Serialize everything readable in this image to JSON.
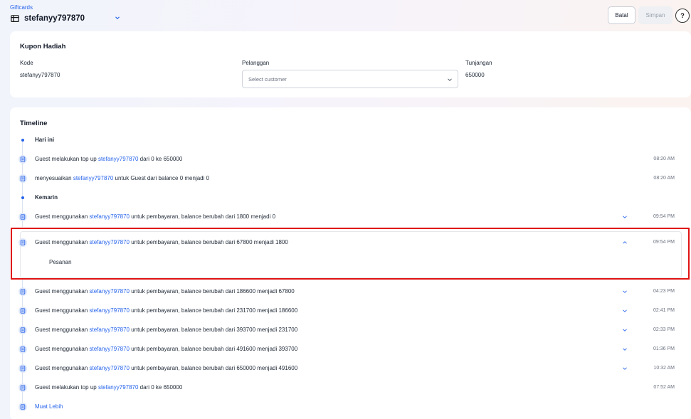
{
  "breadcrumb": "Giftcards",
  "header": {
    "title": "stefanyy797870",
    "icons": {
      "gift": "gift-card-icon",
      "dropdown": "chevron-down-icon"
    },
    "buttons": {
      "cancel": "Batal",
      "save": "Simpan",
      "help": "?"
    }
  },
  "kupon": {
    "title": "Kupon Hadiah",
    "kode_label": "Kode",
    "kode_value": "stefanyy797870",
    "pelanggan_label": "Pelanggan",
    "pelanggan_placeholder": "Select customer",
    "tunjangan_label": "Tunjangan",
    "tunjangan_value": "650000"
  },
  "timeline": {
    "title": "Timeline",
    "groups": {
      "today": "Hari ini",
      "yesterday": "Kemarin"
    },
    "rows": [
      {
        "pre": "Guest melakukan top up ",
        "link": "stefanyy797870",
        "post": " dari 0 ke 650000",
        "time": "08:20 AM"
      },
      {
        "pre": "menyesuaikan ",
        "link": "stefanyy797870",
        "post": " untuk Guest dari balance 0 menjadi 0",
        "time": "08:20 AM"
      },
      {
        "pre": "Guest menggunakan ",
        "link": "stefanyy797870",
        "post": " untuk pembayaran, balance berubah dari 1800 menjadi 0",
        "time": "09:54 PM"
      },
      {
        "pre": "Guest menggunakan ",
        "link": "stefanyy797870",
        "post": " untuk pembayaran, balance berubah dari 67800 menjadi 1800",
        "time": "09:54 PM",
        "detail": "Pesanan"
      },
      {
        "pre": "Guest menggunakan ",
        "link": "stefanyy797870",
        "post": " untuk pembayaran, balance berubah dari 186600 menjadi 67800",
        "time": "04:23 PM"
      },
      {
        "pre": "Guest menggunakan ",
        "link": "stefanyy797870",
        "post": " untuk pembayaran, balance berubah dari 231700 menjadi 186600",
        "time": "02:41 PM"
      },
      {
        "pre": "Guest menggunakan ",
        "link": "stefanyy797870",
        "post": " untuk pembayaran, balance berubah dari 393700 menjadi 231700",
        "time": "02:33 PM"
      },
      {
        "pre": "Guest menggunakan ",
        "link": "stefanyy797870",
        "post": " untuk pembayaran, balance berubah dari 491600 menjadi 393700",
        "time": "01:36 PM"
      },
      {
        "pre": "Guest menggunakan ",
        "link": "stefanyy797870",
        "post": " untuk pembayaran, balance berubah dari 650000 menjadi 491600",
        "time": "10:32 AM"
      },
      {
        "pre": "Guest melakukan top up ",
        "link": "stefanyy797870",
        "post": " dari 0 ke 650000",
        "time": "07:52 AM"
      }
    ],
    "load_more": "Muat Lebih"
  },
  "colors": {
    "accent": "#2563eb",
    "highlight": "#e01313"
  }
}
